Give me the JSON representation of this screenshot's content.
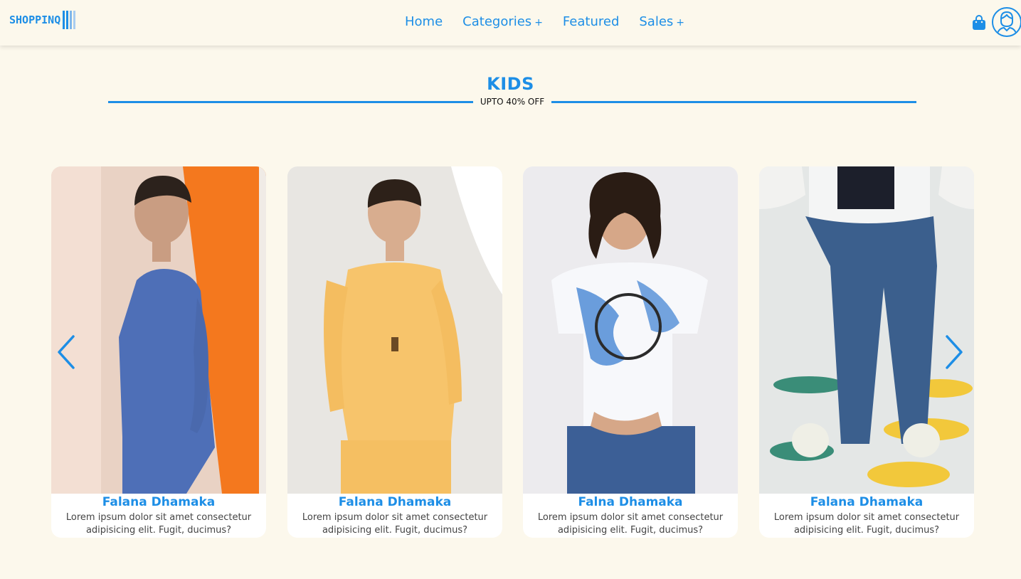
{
  "brand": {
    "logo_text": "SHOPPINQ"
  },
  "nav": {
    "items": [
      {
        "label": "Home",
        "has_plus": false
      },
      {
        "label": "Categories",
        "has_plus": true
      },
      {
        "label": "Featured",
        "has_plus": false
      },
      {
        "label": "Sales",
        "has_plus": true
      }
    ],
    "plus_symbol": "+"
  },
  "header_icons": {
    "bag": "shopping-bag-icon",
    "profile": "user-avatar-icon"
  },
  "section": {
    "title": "KIDS",
    "subtitle": "UPTO 40% OFF"
  },
  "carousel": {
    "prev_icon": "chevron-left-icon",
    "next_icon": "chevron-right-icon",
    "products": [
      {
        "name": "Falana Dhamaka",
        "description": "Lorem ipsum dolor sit amet consectetur adipisicing elit. Fugit, ducimus?"
      },
      {
        "name": "Falana Dhamaka",
        "description": "Lorem ipsum dolor sit amet consectetur adipisicing elit. Fugit, ducimus?"
      },
      {
        "name": "Falna Dhamaka",
        "description": "Lorem ipsum dolor sit amet consectetur adipisicing elit. Fugit, ducimus?"
      },
      {
        "name": "Falana Dhamaka",
        "description": "Lorem ipsum dolor sit amet consectetur adipisicing elit. Fugit, ducimus?"
      }
    ]
  },
  "colors": {
    "accent": "#1d8ee6",
    "background": "#fcf8ec",
    "card": "#ffffff"
  }
}
